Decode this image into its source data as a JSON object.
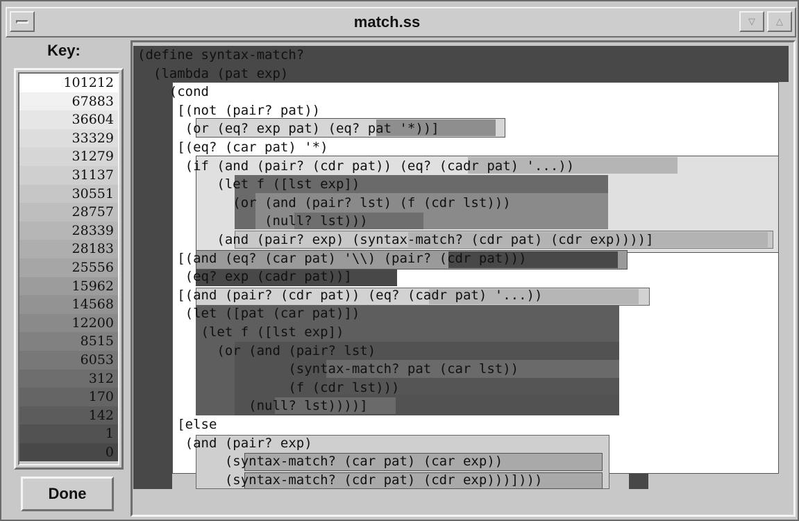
{
  "window": {
    "title": "match.ss",
    "menu_icon": "window-menu-icon",
    "minimize_icon": "triangle-down-icon",
    "maximize_icon": "triangle-up-icon"
  },
  "key": {
    "label": "Key:",
    "entries": [
      {
        "value": "101212",
        "color": "#ffffff"
      },
      {
        "value": "67883",
        "color": "#f0f0f0"
      },
      {
        "value": "36604",
        "color": "#e6e6e6"
      },
      {
        "value": "33329",
        "color": "#dddddd"
      },
      {
        "value": "31279",
        "color": "#d6d6d6"
      },
      {
        "value": "31137",
        "color": "#cfcfcf"
      },
      {
        "value": "30551",
        "color": "#c6c6c6"
      },
      {
        "value": "28757",
        "color": "#bebebe"
      },
      {
        "value": "28339",
        "color": "#b6b6b6"
      },
      {
        "value": "28183",
        "color": "#aeaeae"
      },
      {
        "value": "25556",
        "color": "#a6a6a6"
      },
      {
        "value": "15962",
        "color": "#9c9c9c"
      },
      {
        "value": "14568",
        "color": "#939393"
      },
      {
        "value": "12200",
        "color": "#8a8a8a"
      },
      {
        "value": "8515",
        "color": "#818181"
      },
      {
        "value": "6053",
        "color": "#787878"
      },
      {
        "value": "312",
        "color": "#6e6e6e"
      },
      {
        "value": "170",
        "color": "#656565"
      },
      {
        "value": "142",
        "color": "#5c5c5c"
      },
      {
        "value": "1",
        "color": "#525252"
      },
      {
        "value": "0",
        "color": "#484848"
      }
    ]
  },
  "done_label": "Done",
  "code": {
    "lines": [
      "(define syntax-match?",
      "  (lambda (pat exp)",
      "    (cond",
      "     [(not (pair? pat))",
      "      (or (eq? exp pat) (eq? pat '*))]",
      "     [(eq? (car pat) '*)",
      "      (if (and (pair? (cdr pat)) (eq? (cadr pat) '...))",
      "          (let f ([lst exp])",
      "            (or (and (pair? lst) (f (cdr lst)))",
      "                (null? lst)))",
      "          (and (pair? exp) (syntax-match? (cdr pat) (cdr exp))))]",
      "     [(and (eq? (car pat) '\\\\) (pair? (cdr pat)))",
      "      (eq? exp (cadr pat))]",
      "     [(and (pair? (cdr pat)) (eq? (cadr pat) '...))",
      "      (let ([pat (car pat)])",
      "        (let f ([lst exp])",
      "          (or (and (pair? lst)",
      "                   (syntax-match? pat (car lst))",
      "                   (f (cdr lst)))",
      "              (null? lst))))]",
      "     [else",
      "      (and (pair? exp)",
      "           (syntax-match? (car pat) (car exp))",
      "           (syntax-match? (cdr pat) (cdr exp)))])))"
    ]
  }
}
